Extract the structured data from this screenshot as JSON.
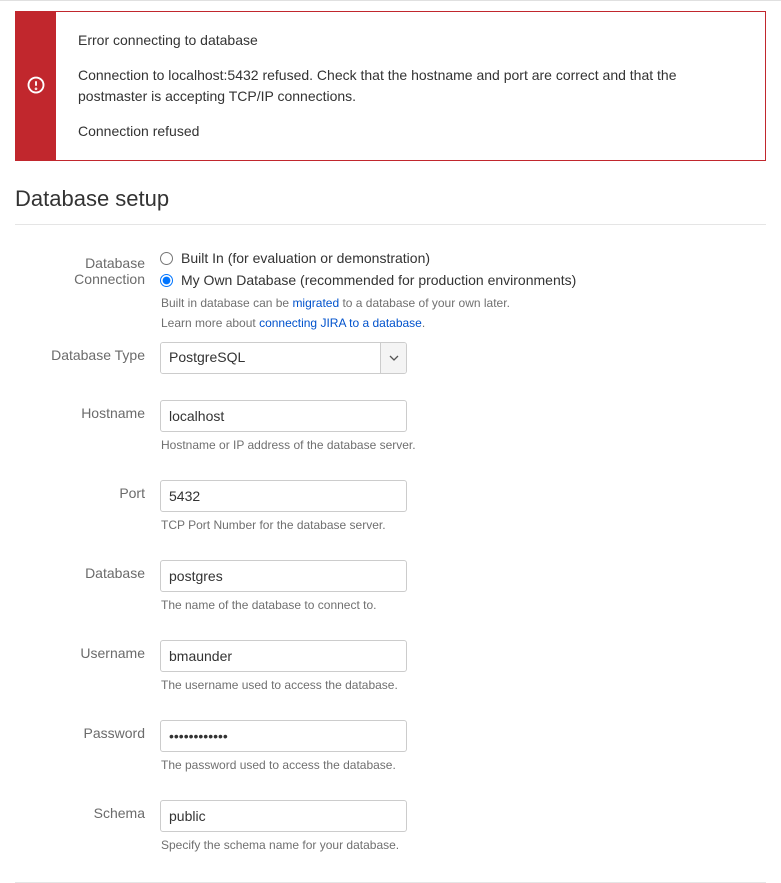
{
  "error": {
    "title": "Error connecting to database",
    "message": "Connection to localhost:5432 refused. Check that the hostname and port are correct and that the postmaster is accepting TCP/IP connections.",
    "reason": "Connection refused"
  },
  "page_title": "Database setup",
  "labels": {
    "db_connection": "Database Connection",
    "db_type": "Database Type",
    "hostname": "Hostname",
    "port": "Port",
    "database": "Database",
    "username": "Username",
    "password": "Password",
    "schema": "Schema"
  },
  "radios": {
    "builtin": "Built In (for evaluation or demonstration)",
    "own": "My Own Database (recommended for production environments)"
  },
  "help": {
    "builtin_prefix": "Built in database can be ",
    "builtin_link": "migrated",
    "builtin_suffix": " to a database of your own later.",
    "learn_prefix": "Learn more about ",
    "learn_link": "connecting JIRA to a database",
    "learn_suffix": ".",
    "hostname": "Hostname or IP address of the database server.",
    "port": "TCP Port Number for the database server.",
    "database": "The name of the database to connect to.",
    "username": "The username used to access the database.",
    "password": "The password used to access the database.",
    "schema": "Specify the schema name for your database."
  },
  "values": {
    "db_type": "PostgreSQL",
    "hostname": "localhost",
    "port": "5432",
    "database": "postgres",
    "username": "bmaunder",
    "password": "••••••••••••",
    "schema": "public"
  }
}
